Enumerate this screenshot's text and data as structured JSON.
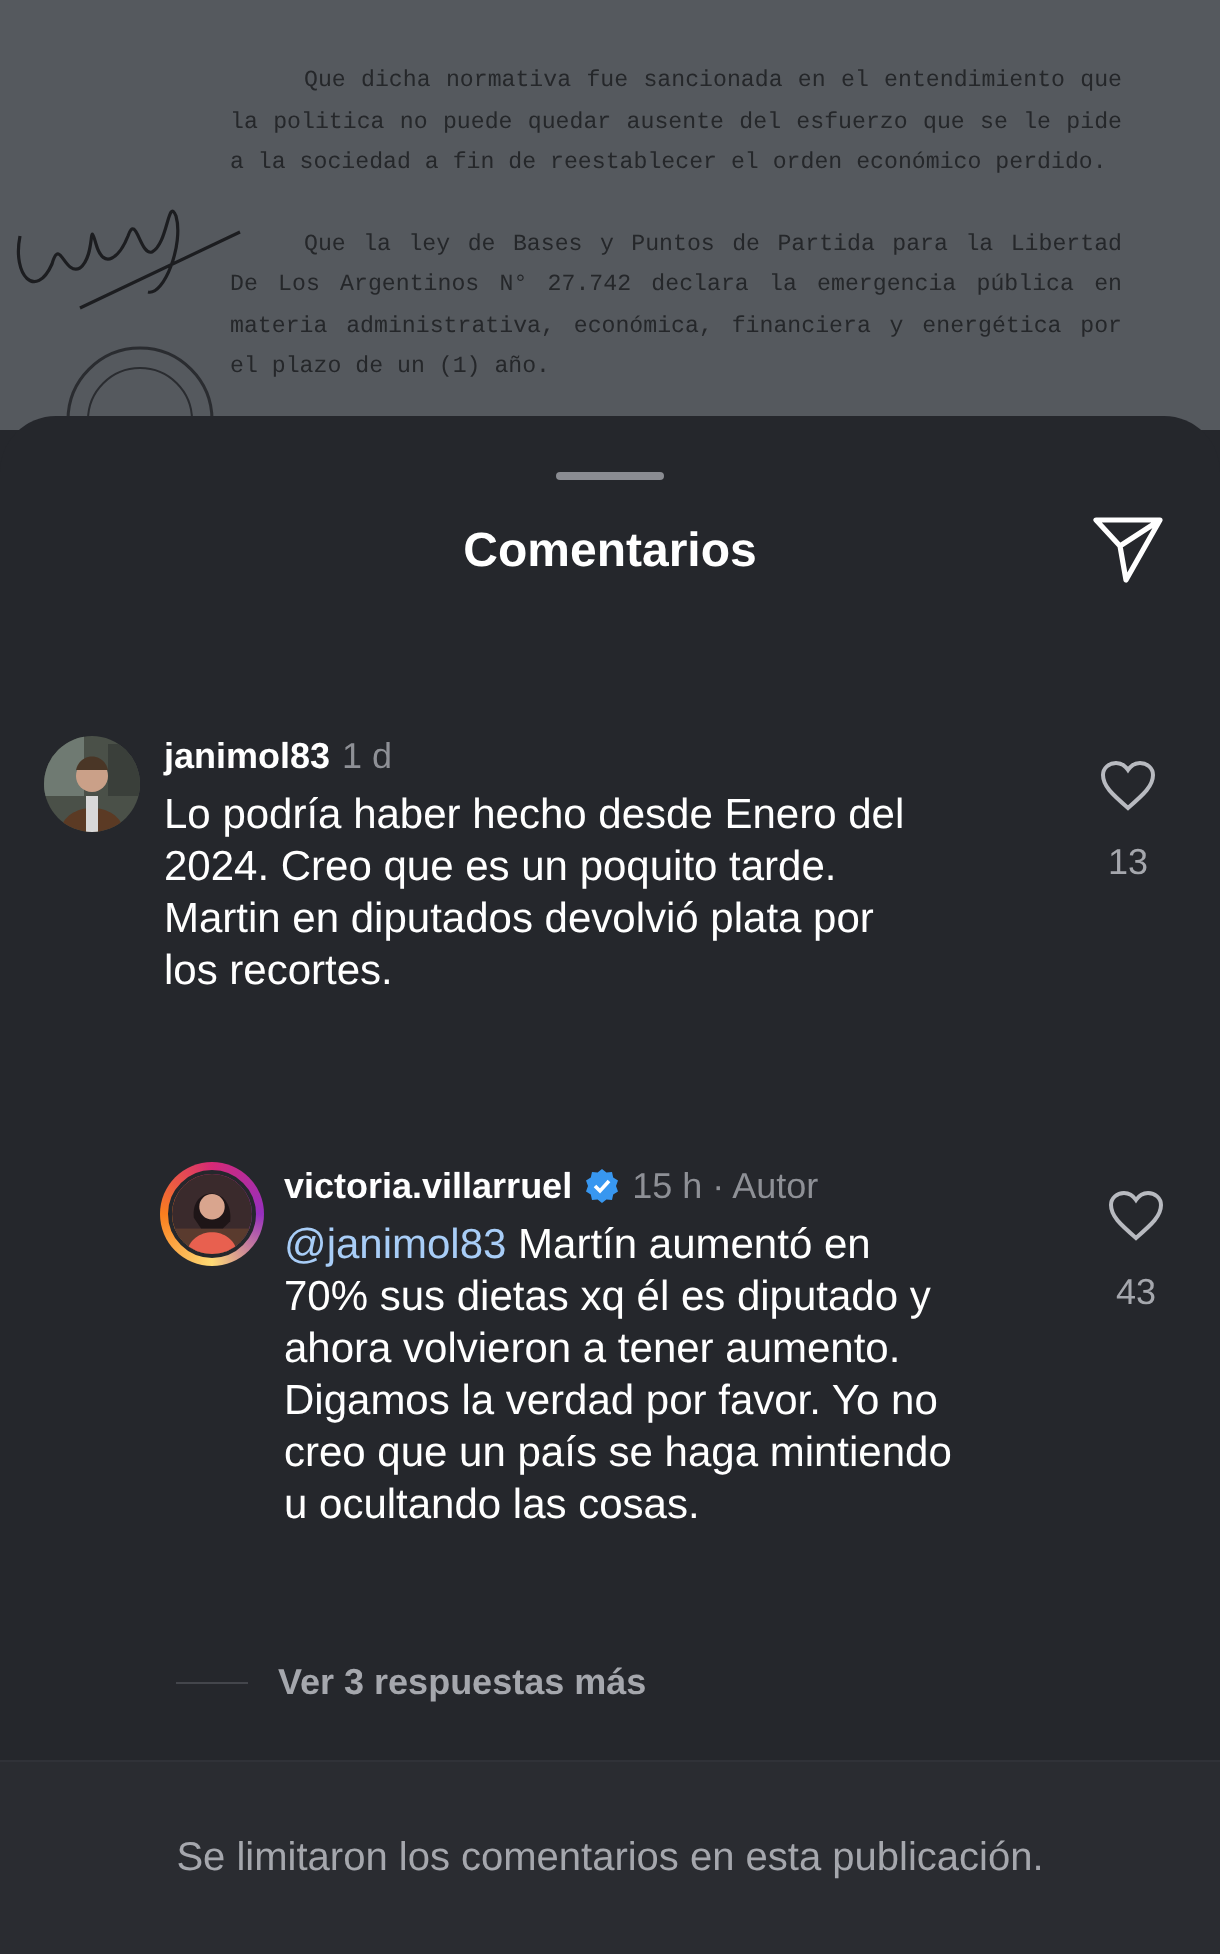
{
  "document": {
    "paragraphs": [
      "Que dicha normativa fue sancionada en el entendimiento que la politica no puede quedar ausente del esfuerzo que se le pide a la sociedad a fin de reestablecer el orden económico perdido.",
      "Que la ley de Bases y Puntos de Partida para la Libertad De Los Argentinos N° 27.742 declara la emergencia pública en materia administrativa, económica, financiera y energética por el plazo de un (1) año."
    ]
  },
  "sheet": {
    "title": "Comentarios"
  },
  "comments": [
    {
      "username": "janimol83",
      "verified": false,
      "time": "1 d",
      "text": "Lo podría haber hecho desde Enero del\n2024. Creo que es un poquito tarde.\nMartin en diputados devolvió plata por\nlos recortes.",
      "likes": "13",
      "liked": false,
      "is_reply": false,
      "story_ring": false
    },
    {
      "username": "victoria.villarruel",
      "verified": true,
      "time": "15 h",
      "author_tag": "· Autor",
      "mention": "@janimol83",
      "text": "Martín aumentó en\n70% sus dietas xq él es diputado y\nahora volvieron a tener aumento.\nDigamos la verdad por favor. Yo no\ncreo que un país se haga mintiendo\nu ocultando las cosas.",
      "likes": "43",
      "liked": false,
      "is_reply": true,
      "story_ring": true
    }
  ],
  "more_replies": "Ver 3 respuestas más",
  "footer_notice": "Se limitaron los comentarios en esta publicación."
}
